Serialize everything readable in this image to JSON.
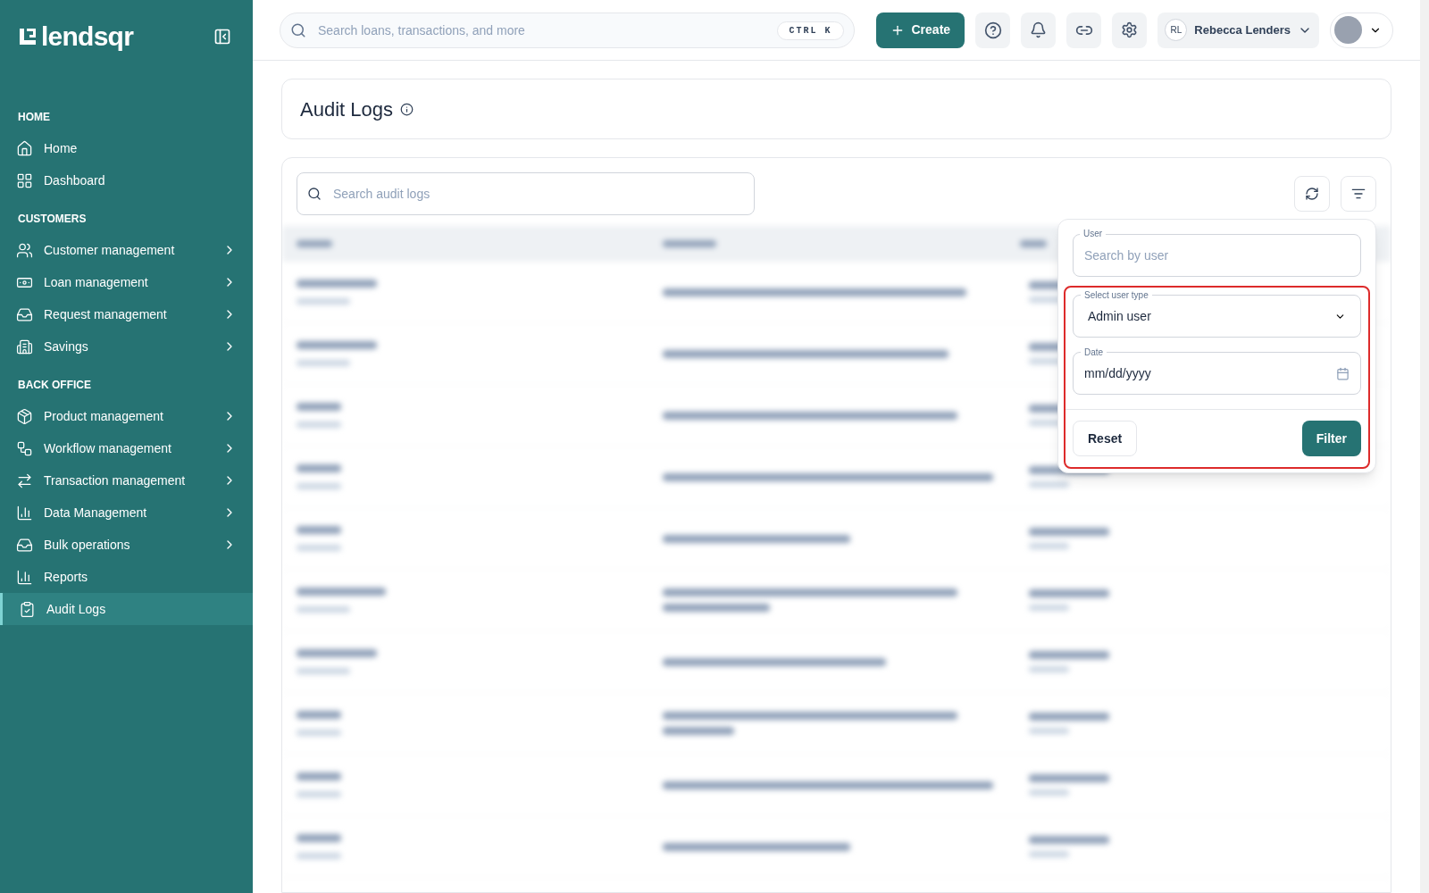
{
  "sidebar": {
    "logo": "lendsqr",
    "sections": [
      {
        "heading": "HOME",
        "items": [
          {
            "label": "Home",
            "expandable": false,
            "selected": false
          },
          {
            "label": "Dashboard",
            "expandable": false,
            "selected": false
          }
        ]
      },
      {
        "heading": "CUSTOMERS",
        "items": [
          {
            "label": "Customer management",
            "expandable": true,
            "selected": false
          },
          {
            "label": "Loan management",
            "expandable": true,
            "selected": false
          },
          {
            "label": "Request management",
            "expandable": true,
            "selected": false
          },
          {
            "label": "Savings",
            "expandable": true,
            "selected": false
          }
        ]
      },
      {
        "heading": "BACK OFFICE",
        "items": [
          {
            "label": "Product management",
            "expandable": true,
            "selected": false
          },
          {
            "label": "Workflow management",
            "expandable": true,
            "selected": false
          },
          {
            "label": "Transaction management",
            "expandable": true,
            "selected": false
          },
          {
            "label": "Data Management",
            "expandable": true,
            "selected": false
          },
          {
            "label": "Bulk operations",
            "expandable": true,
            "selected": false
          },
          {
            "label": "Reports",
            "expandable": false,
            "selected": false
          },
          {
            "label": "Audit Logs",
            "expandable": false,
            "selected": true
          }
        ]
      }
    ]
  },
  "topbar": {
    "search": {
      "placeholder": "Search loans, transactions, and more",
      "shortcut": "CTRL K"
    },
    "create_button": "Create",
    "user": {
      "initials": "RL",
      "name": "Rebecca Lenders"
    }
  },
  "page": {
    "title": "Audit Logs",
    "search": {
      "placeholder": "Search audit logs"
    }
  },
  "filter_panel": {
    "user_field": {
      "label": "User",
      "placeholder": "Search by user"
    },
    "user_type_field": {
      "label": "Select user type",
      "value": "Admin user"
    },
    "date_field": {
      "label": "Date",
      "value": "mm/dd/yyyy"
    },
    "reset_button": "Reset",
    "filter_button": "Filter"
  }
}
